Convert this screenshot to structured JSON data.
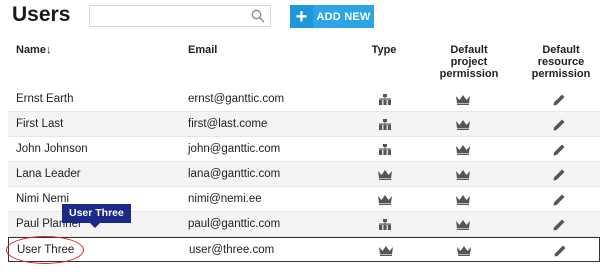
{
  "header": {
    "title": "Users",
    "search_placeholder": "",
    "search_value": "",
    "add_button_icon": "plus-icon",
    "add_button_label": "ADD NEW"
  },
  "columns": {
    "name": "Name↓",
    "email": "Email",
    "type": "Type",
    "project_permission": [
      "Default",
      "project",
      "permission"
    ],
    "resource_permission": [
      "Default",
      "resource",
      "permission"
    ]
  },
  "users": [
    {
      "name": "Ernst Earth",
      "email": "ernst@ganttic.com"
    },
    {
      "name": "First Last",
      "email": "first@last.come"
    },
    {
      "name": "John Johnson",
      "email": "john@ganttic.com"
    },
    {
      "name": "Lana Leader",
      "email": "lana@ganttic.com"
    },
    {
      "name": "Nimi Nemi",
      "email": "nimi@nemi.ee"
    },
    {
      "name": "Paul Planner",
      "email": "paul@ganttic.com"
    },
    {
      "name": "User Three",
      "email": "user@three.com"
    }
  ],
  "tooltip": "User Three",
  "icons": {
    "type": "org-chart-icon",
    "project_permission": "crown-icon",
    "resource_permission": "pencil-icon"
  },
  "colors": {
    "accent": "#2ca4e6",
    "tooltip_bg": "#1b2a8a",
    "highlight_circle": "#e02020"
  }
}
